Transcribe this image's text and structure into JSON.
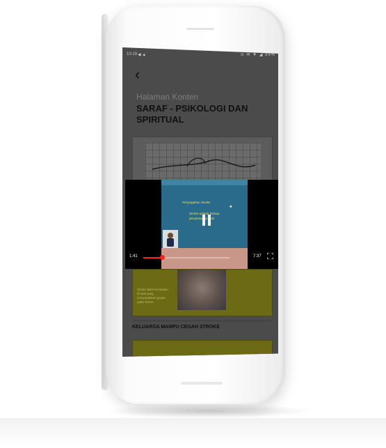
{
  "status_bar": {
    "time": "10:19",
    "left_icons": "◀ ▲",
    "right_icons": "⊙ ✉ ▼ ◢ 95%"
  },
  "header": {
    "back_icon": "‹",
    "subtitle": "Halaman Konten",
    "title": "SARAF - PSIKOLOGI DAN SPIRITUAL"
  },
  "video_player": {
    "slide_heading": "Penyegahan Stroke",
    "slide_body_line1": "Stroke adalah bahwa",
    "slide_body_line2": "penyempitan otak",
    "current_time": "1:41",
    "total_time": "7:37",
    "progress": 0.22,
    "state": "playing",
    "controls": [
      "pause-icon",
      "fullscreen-icon"
    ]
  },
  "content_cards": [
    {
      "description": "Stroke ialah kerusakan di otak yang menyebabkan gejala pada sistem",
      "label": "KELUARGA MAMPU CEGAH STROKE"
    }
  ],
  "colors": {
    "overlay": "#4b4b4b",
    "progress": "#ff2020",
    "slide_bg": "#2a6a8a",
    "card_bg": "#6d6a15"
  }
}
